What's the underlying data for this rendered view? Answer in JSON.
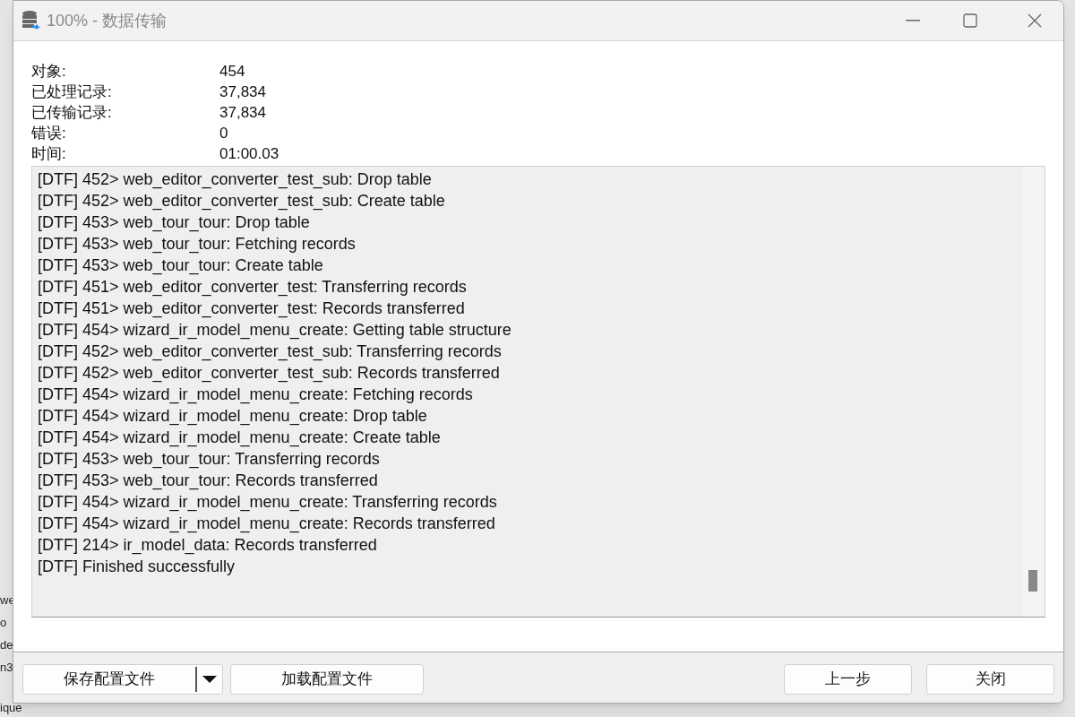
{
  "background_fragments": [
    "we",
    "o",
    "de",
    "n3"
  ],
  "background_bottom": "ique",
  "window": {
    "title": "100% - 数据传输"
  },
  "stats": [
    {
      "label": "对象:",
      "value": "454"
    },
    {
      "label": "已处理记录:",
      "value": "37,834"
    },
    {
      "label": "已传输记录:",
      "value": "37,834"
    },
    {
      "label": "错误:",
      "value": "0"
    },
    {
      "label": "时间:",
      "value": "01:00.03"
    }
  ],
  "log": [
    "[DTF] 452> web_editor_converter_test_sub: Drop table",
    "[DTF] 452> web_editor_converter_test_sub: Create table",
    "[DTF] 453> web_tour_tour: Drop table",
    "[DTF] 453> web_tour_tour: Fetching records",
    "[DTF] 453> web_tour_tour: Create table",
    "[DTF] 451> web_editor_converter_test: Transferring records",
    "[DTF] 451> web_editor_converter_test: Records transferred",
    "[DTF] 454> wizard_ir_model_menu_create: Getting table structure",
    "[DTF] 452> web_editor_converter_test_sub: Transferring records",
    "[DTF] 452> web_editor_converter_test_sub: Records transferred",
    "[DTF] 454> wizard_ir_model_menu_create: Fetching records",
    "[DTF] 454> wizard_ir_model_menu_create: Drop table",
    "[DTF] 454> wizard_ir_model_menu_create: Create table",
    "[DTF] 453> web_tour_tour: Transferring records",
    "[DTF] 453> web_tour_tour: Records transferred",
    "[DTF] 454> wizard_ir_model_menu_create: Transferring records",
    "[DTF] 454> wizard_ir_model_menu_create: Records transferred",
    "[DTF] 214> ir_model_data: Records transferred",
    "[DTF] Finished successfully"
  ],
  "buttons_left": [
    {
      "label": "保存配置文件",
      "kind": "split"
    },
    {
      "label": "加载配置文件",
      "kind": "plain"
    }
  ],
  "buttons_right": [
    {
      "label": "上一步",
      "kind": "plain"
    },
    {
      "label": "关闭",
      "kind": "plain"
    }
  ]
}
